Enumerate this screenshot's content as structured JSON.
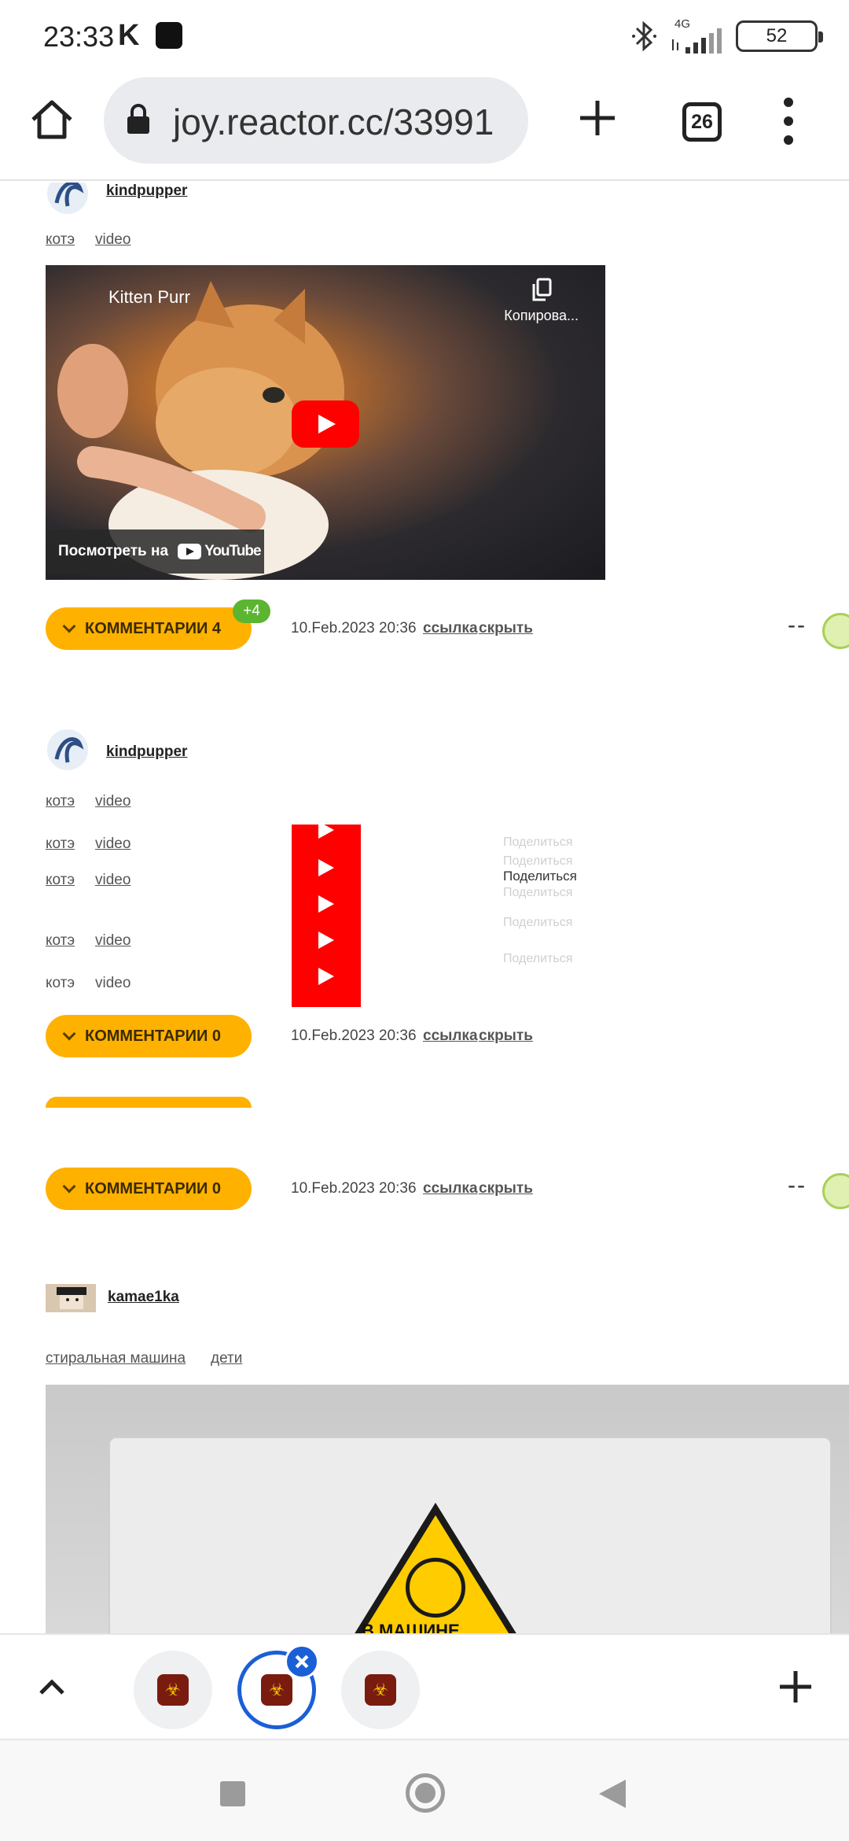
{
  "status_bar": {
    "time": "23:33",
    "notif_letter": "K",
    "network": "4G",
    "battery": "52"
  },
  "browser": {
    "url": "joy.reactor.cc/33991",
    "tab_count": "26"
  },
  "posts": [
    {
      "username": "kindpupper",
      "tags": [
        "котэ",
        "video"
      ],
      "video": {
        "title": "Kitten Purr",
        "copy_label": "Копирова...",
        "watch_label": "Посмотреть на",
        "platform": "YouTube"
      },
      "comments_label": "КОММЕНТАРИИ 4",
      "new_badge": "+4",
      "date": "10.Feb.2023 20:36",
      "link_label": "ссылка",
      "hide_label": "скрыть",
      "rating": "--"
    },
    {
      "username": "kindpupper",
      "tags": [
        "котэ",
        "video"
      ],
      "glitch_tags": [
        [
          "котэ",
          "video"
        ],
        [
          "котэ",
          "video"
        ],
        [
          "котэ",
          "video"
        ],
        [
          "котэ",
          "video"
        ]
      ],
      "share_labels": [
        "Поделиться",
        "Поделиться",
        "Поделиться",
        "Поделиться",
        "Поделиться",
        "Поделиться"
      ],
      "comments_label": "КОММЕНТАРИИ 0",
      "date": "10.Feb.2023 20:36",
      "link_label": "ссылка",
      "hide_label": "скрыть"
    },
    {
      "comments_label": "КОММЕНТАРИИ 0",
      "date": "10.Feb.2023 20:36",
      "link_label": "ссылка",
      "hide_label": "скрыть",
      "rating": "--"
    },
    {
      "username": "kamae1ka",
      "tags": [
        "стиральная машина",
        "дети"
      ],
      "image_text": "В МАШИНЕ"
    }
  ],
  "colors": {
    "accent": "#ffb100",
    "badge": "#5cb531",
    "tab_active": "#1a5fd6",
    "youtube": "#ff0000"
  },
  "icons": [
    "home-icon",
    "lock-icon",
    "plus-icon",
    "tab-switcher-icon",
    "more-vert-icon",
    "chevron-up-icon",
    "close-icon",
    "smile-icon"
  ]
}
